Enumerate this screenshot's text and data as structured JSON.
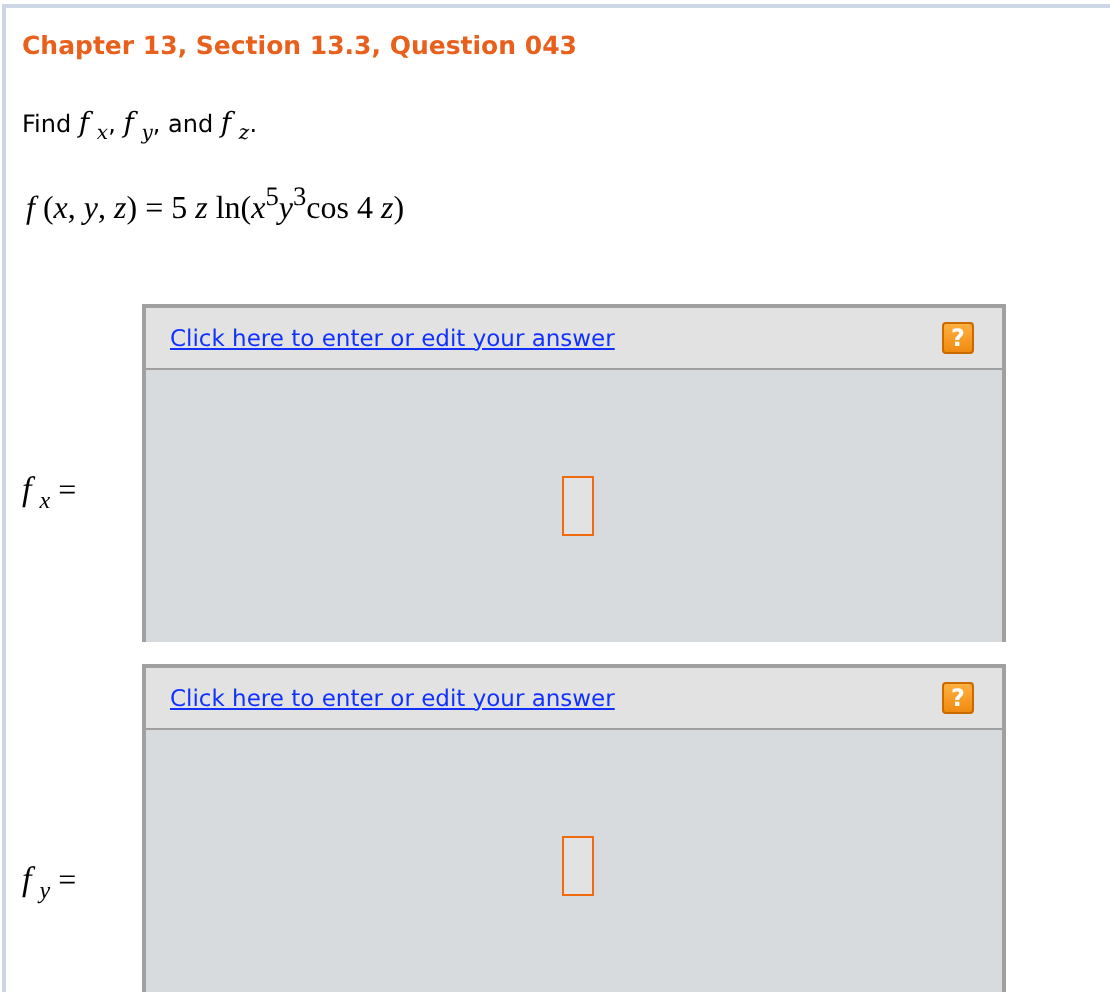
{
  "heading": "Chapter 13, Section 13.3, Question 043",
  "prompt": "Find *f* $_{x}$, *f* $_{y}$, and *f* $_{z}$.",
  "formula": "*f* (*x*, *y*, *z*) = 5 *z* ln(*x*$^{5}$*y*$^{3}$cos 4 *z*)",
  "answers": [
    {
      "label": "*f* $_{x}$ =",
      "link": "Click here to enter or edit your answer",
      "help": "?"
    },
    {
      "label": "*f* $_{y}$ =",
      "link": "Click here to enter or edit your answer",
      "help": "?"
    }
  ]
}
